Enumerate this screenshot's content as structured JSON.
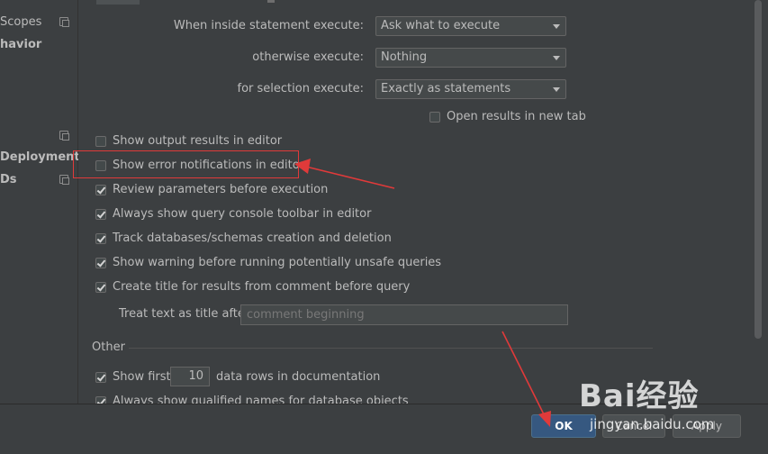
{
  "sidebar": {
    "items": [
      {
        "label": "Scopes",
        "bold": false
      },
      {
        "label": "havior",
        "bold": true
      },
      {
        "label": "Deployment",
        "bold": true
      },
      {
        "label": "Ds",
        "bold": true
      }
    ]
  },
  "execute": {
    "inside_label": "When inside statement execute:",
    "inside_value": "Ask what to execute",
    "otherwise_label": "otherwise execute:",
    "otherwise_value": "Nothing",
    "selection_label": "for selection execute:",
    "selection_value": "Exactly as statements",
    "open_new_tab_label": "Open results in new tab"
  },
  "options": [
    {
      "label": "Show output results in editor",
      "checked": false
    },
    {
      "label": "Show error notifications in editor",
      "checked": false
    },
    {
      "label": "Review parameters before execution",
      "checked": true
    },
    {
      "label": "Always show query console toolbar in editor",
      "checked": true
    },
    {
      "label": "Track databases/schemas creation and deletion",
      "checked": true
    },
    {
      "label": "Show warning before running potentially unsafe queries",
      "checked": true
    },
    {
      "label": "Create title for results from comment before query",
      "checked": true
    }
  ],
  "title_after": {
    "label": "Treat text as title after",
    "placeholder": "comment beginning"
  },
  "other": {
    "section_title": "Other",
    "show_first_label": "Show first",
    "show_first_value": "10",
    "show_first_suffix": "data rows in documentation",
    "partial_label": "Always show qualified names for database objects"
  },
  "buttons": {
    "ok": "OK",
    "cancel": "Cancel",
    "apply": "Apply"
  },
  "watermark": {
    "logo": "Bai经验",
    "url": "jingyan.baidu.com"
  },
  "colors": {
    "background": "#3c3f41",
    "accent_ok": "#365880",
    "annotation_red": "#e03a3a"
  }
}
